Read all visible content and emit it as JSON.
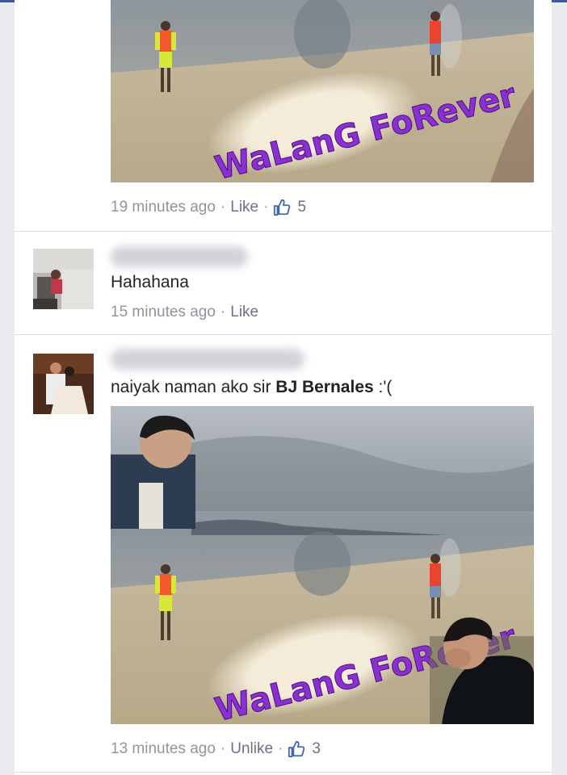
{
  "comments": [
    {
      "name_hidden": true,
      "timestamp": "19 minutes ago",
      "action": "Like",
      "like_count": "5",
      "banner_text": "WaLanG FoRever"
    },
    {
      "name_hidden": true,
      "text": "Hahahana",
      "timestamp": "15 minutes ago",
      "action": "Like"
    },
    {
      "name_hidden": true,
      "text_prefix": "naiyak naman ako sir ",
      "mention": "BJ Bernales",
      "text_suffix": " :'(",
      "timestamp": "13 minutes ago",
      "action": "Unlike",
      "like_count": "3",
      "banner_text": "WaLanG FoRever"
    }
  ],
  "separator": "·",
  "colors": {
    "link": "#6b7285",
    "meta": "#90949c",
    "like_thumb": "#4267b2",
    "banner_text": "#8a2fd0"
  },
  "icons": {
    "like": "thumbs-up-icon"
  }
}
